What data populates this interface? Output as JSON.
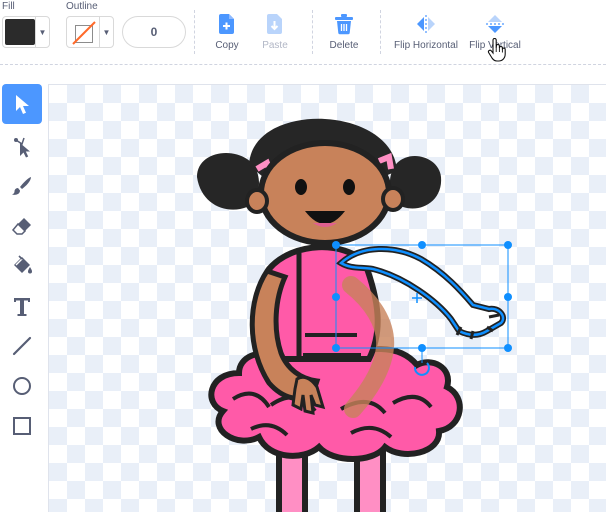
{
  "toolbar": {
    "fill_label": "Fill",
    "fill_color": "#2b2b2b",
    "outline_label": "Outline",
    "outline_color": "none",
    "outline_width": "0",
    "copy_label": "Copy",
    "paste_label": "Paste",
    "delete_label": "Delete",
    "flip_horizontal_label": "Flip Horizontal",
    "flip_vertical_label": "Flip Vertical"
  },
  "tools": [
    {
      "name": "select",
      "icon": "arrow-pointer-icon",
      "active": true
    },
    {
      "name": "reshape",
      "icon": "reshape-icon",
      "active": false
    },
    {
      "name": "brush",
      "icon": "brush-icon",
      "active": false
    },
    {
      "name": "eraser",
      "icon": "eraser-icon",
      "active": false
    },
    {
      "name": "fill",
      "icon": "paint-bucket-icon",
      "active": false
    },
    {
      "name": "text",
      "icon": "text-icon",
      "active": false
    },
    {
      "name": "line",
      "icon": "line-icon",
      "active": false
    },
    {
      "name": "circle",
      "icon": "circle-icon",
      "active": false
    },
    {
      "name": "rectangle",
      "icon": "rectangle-icon",
      "active": false
    }
  ],
  "colors": {
    "accent": "#4c97ff",
    "selection": "#0f8fff",
    "skin": "#c8825a",
    "dress_pink": "#ff5aa8",
    "hair": "#262626"
  }
}
